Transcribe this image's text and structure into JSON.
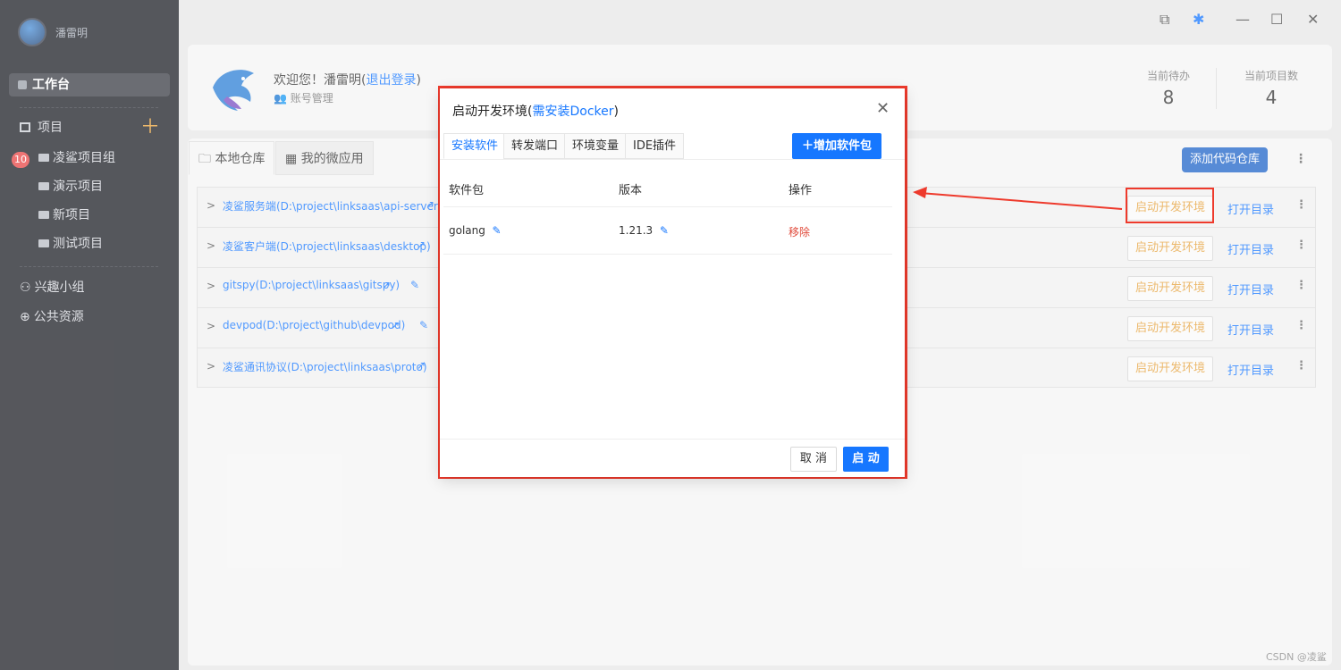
{
  "sidebar": {
    "username": "潘雷明",
    "workbench": "工作台",
    "projects_label": "项目",
    "project_items": [
      "凌鲨项目组",
      "演示项目",
      "新项目",
      "测试项目"
    ],
    "badge": "10",
    "interest_group": "兴趣小组",
    "public_resource": "公共资源"
  },
  "header": {
    "welcome_prefix": "欢迎您！潘雷明(",
    "logout": "退出登录",
    "welcome_suffix": ")",
    "account_manage": "账号管理",
    "todo_label": "当前待办",
    "todo_value": "8",
    "project_count_label": "当前项目数",
    "project_count_value": "4"
  },
  "tabs": {
    "local_repo": "本地仓库",
    "micro_app": "我的微应用",
    "add_repo": "添加代码仓库"
  },
  "repos": [
    {
      "path": "凌鲨服务端(D:\\project\\linksaas\\api-server)"
    },
    {
      "path": "凌鲨客户端(D:\\project\\linksaas\\desktop)"
    },
    {
      "path": "gitspy(D:\\project\\linksaas\\gitspy)"
    },
    {
      "path": "devpod(D:\\project\\github\\devpod)"
    },
    {
      "path": "凌鲨通讯协议(D:\\project\\linksaas\\proto)"
    }
  ],
  "repo_actions": {
    "start_env": "启动开发环境",
    "open_dir": "打开目录"
  },
  "modal": {
    "title_prefix": "启动开发环境(",
    "title_em": "需安装Docker",
    "title_suffix": ")",
    "tabs": [
      "安装软件",
      "转发端口",
      "环境变量",
      "IDE插件"
    ],
    "add_pkg": "增加软件包",
    "columns": [
      "软件包",
      "版本",
      "操作"
    ],
    "rows": [
      {
        "pkg": "golang",
        "version": "1.21.3",
        "action": "移除"
      }
    ],
    "cancel": "取 消",
    "start": "启 动"
  },
  "watermark": "CSDN @凌鲨",
  "colors": {
    "accent": "#1677ff",
    "highlight": "#ee3a2c",
    "warn": "#e6a23c"
  }
}
